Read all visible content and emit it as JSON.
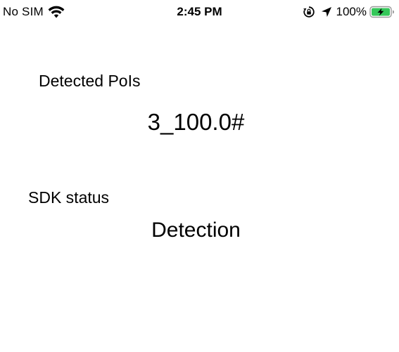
{
  "status_bar": {
    "carrier": "No SIM",
    "time": "2:45 PM",
    "battery_percent": "100%",
    "icons": {
      "wifi": "wifi-icon",
      "orientation_lock": "orientation-lock-icon",
      "location": "location-arrow-icon",
      "battery": "battery-charging-icon"
    },
    "battery_level": 1.0,
    "battery_color": "#34c759"
  },
  "main": {
    "detected_pois_label": "Detected PoIs",
    "detected_pois_value": "3_100.0#",
    "sdk_status_label": "SDK status",
    "sdk_status_value": "Detection"
  }
}
